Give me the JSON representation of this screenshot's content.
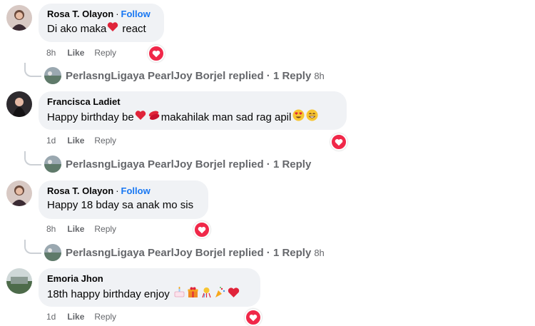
{
  "comments": [
    {
      "author": "Rosa T. Olayon",
      "follow": "Follow",
      "text_parts": [
        "Di ako maka ",
        "react"
      ],
      "emojis": [
        "red-heart"
      ],
      "time": "8h",
      "like": "Like",
      "reply": "Reply",
      "reaction": "love",
      "replies": {
        "text": "PerlasngLigaya PearlJoy Borjel replied · 1 Reply",
        "time": "8h"
      }
    },
    {
      "author": "Francisca Ladiet",
      "text_parts": [
        "Happy birthday be",
        " makahilak man sad rag apil"
      ],
      "emojis": [
        "red-heart",
        "kiss-lips",
        "heart-eyes-face",
        "grinning-face"
      ],
      "time": "1d",
      "like": "Like",
      "reply": "Reply",
      "reaction": "love",
      "replies": {
        "text": "PerlasngLigaya PearlJoy Borjel replied · 1 Reply",
        "time": ""
      }
    },
    {
      "author": "Rosa T. Olayon",
      "follow": "Follow",
      "text": "Happy 18 bday sa anak mo sis",
      "time": "8h",
      "like": "Like",
      "reply": "Reply",
      "reaction": "love",
      "replies": {
        "text": "PerlasngLigaya PearlJoy Borjel replied · 1 Reply",
        "time": "8h"
      }
    },
    {
      "author": "Emoria Jhon",
      "text": "18th happy birthday enjoy ",
      "emojis": [
        "birthday-cake",
        "gift",
        "confetti-ball",
        "party-popper",
        "red-heart"
      ],
      "time": "1d",
      "like": "Like",
      "reply": "Reply",
      "reaction": "love"
    }
  ],
  "colors": {
    "bubble": "#f0f2f5",
    "follow": "#1877f2",
    "love": "#f02849",
    "meta": "#65676b"
  }
}
